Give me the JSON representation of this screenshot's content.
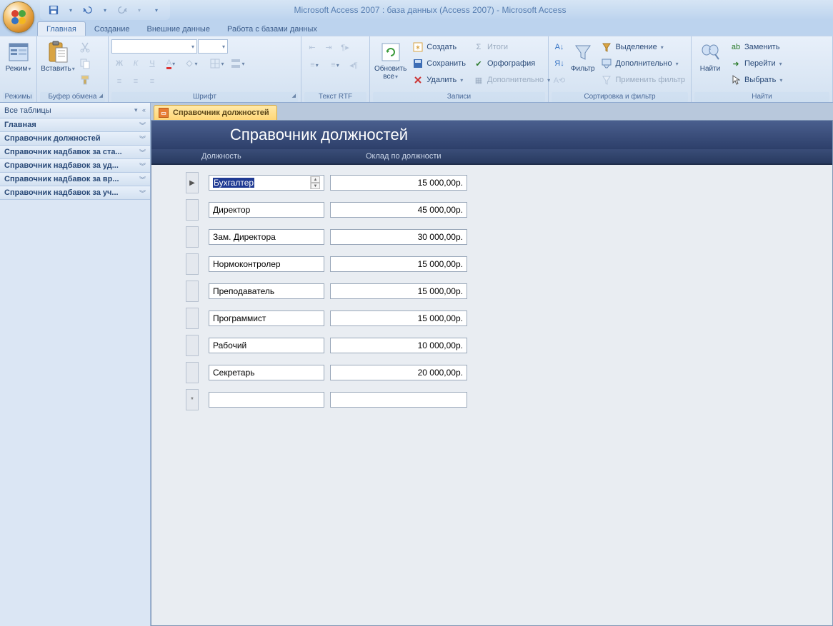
{
  "title": "Microsoft Access 2007 : база данных (Access 2007)  -  Microsoft Access",
  "tabs": {
    "home": "Главная",
    "create": "Создание",
    "external": "Внешние данные",
    "dbtools": "Работа с базами данных"
  },
  "ribbon": {
    "view": "Режим",
    "paste": "Вставить",
    "g_views": "Режимы",
    "g_clipboard": "Буфер обмена",
    "g_font": "Шрифт",
    "g_rtf": "Текст RTF",
    "refresh": "Обновить все",
    "rec_new": "Создать",
    "rec_save": "Сохранить",
    "rec_delete": "Удалить",
    "rec_totals": "Итоги",
    "rec_spell": "Орфография",
    "rec_more": "Дополнительно",
    "g_records": "Записи",
    "filter": "Фильтр",
    "sf_selection": "Выделение",
    "sf_advanced": "Дополнительно",
    "sf_toggle": "Применить фильтр",
    "g_sortfilter": "Сортировка и фильтр",
    "find": "Найти",
    "f_replace": "Заменить",
    "f_goto": "Перейти",
    "f_select": "Выбрать",
    "g_find": "Найти"
  },
  "nav": {
    "header": "Все таблицы",
    "items": [
      "Главная",
      "Справочник должностей",
      "Справочник надбавок за ста...",
      "Справочник надбавок за уд...",
      "Справочник надбавок за вр...",
      "Справочник надбавок за уч..."
    ]
  },
  "doctab": "Справочник должностей",
  "form": {
    "title": "Справочник должностей",
    "col1": "Должность",
    "col2": "Оклад по должности",
    "rows": [
      {
        "position": "Бухгалтер",
        "salary": "15 000,00р.",
        "active": true
      },
      {
        "position": "Директор",
        "salary": "45 000,00р."
      },
      {
        "position": "Зам. Директора",
        "salary": "30 000,00р."
      },
      {
        "position": "Нормоконтролер",
        "salary": "15 000,00р."
      },
      {
        "position": "Преподаватель",
        "salary": "15 000,00р."
      },
      {
        "position": "Программист",
        "salary": "15 000,00р."
      },
      {
        "position": "Рабочий",
        "salary": "10 000,00р."
      },
      {
        "position": "Секретарь",
        "salary": "20 000,00р."
      }
    ]
  }
}
